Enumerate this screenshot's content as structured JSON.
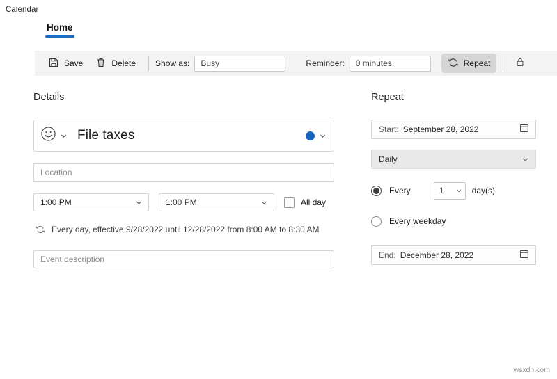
{
  "window": {
    "app_title": "Calendar"
  },
  "tabs": [
    {
      "label": "Home",
      "active": true
    }
  ],
  "ribbon": {
    "save_label": "Save",
    "save_icon": "save-floppy-icon",
    "delete_label": "Delete",
    "delete_icon": "trash-icon",
    "show_as_label": "Show as:",
    "show_as_value": "Busy",
    "reminder_label": "Reminder:",
    "reminder_value": "0 minutes",
    "repeat_label": "Repeat",
    "repeat_icon": "repeat-circular-arrows-icon",
    "repeat_pressed": true,
    "private_icon": "lock-icon"
  },
  "details": {
    "heading": "Details",
    "emoji_icon": "smiley-face-icon",
    "emoji_chevron_icon": "chevron-down-icon",
    "event_title": "File taxes",
    "color_dot_icon": "color-swatch-icon",
    "color_dot_hex": "#1565c0",
    "color_chevron_icon": "chevron-down-icon",
    "location_placeholder": "Location",
    "start_time": "1:00 PM",
    "end_time": "1:00 PM",
    "all_day_label": "All day",
    "all_day_checked": false,
    "recurrence_icon": "repeat-circular-arrows-icon",
    "recurrence_summary": "Every day, effective 9/28/2022 until 12/28/2022 from 8:00 AM to 8:30 AM",
    "description_placeholder": "Event description"
  },
  "repeat": {
    "heading": "Repeat",
    "start_label": "Start:",
    "start_value": "September 28, 2022",
    "start_calendar_icon": "calendar-icon",
    "frequency_value": "Daily",
    "frequency_chevron_icon": "chevron-down-icon",
    "every_label": "Every",
    "every_selected": true,
    "interval_value": "1",
    "interval_chevron_icon": "chevron-down-icon",
    "unit_label": "day(s)",
    "weekday_label": "Every weekday",
    "weekday_selected": false,
    "end_label": "End:",
    "end_value": "December 28, 2022",
    "end_calendar_icon": "calendar-icon"
  },
  "watermark": {
    "text": "wsxdn.com"
  },
  "colors": {
    "accent": "#1a6fc4",
    "event_color": "#1565c0",
    "ribbon_bg": "#f3f3f3"
  }
}
